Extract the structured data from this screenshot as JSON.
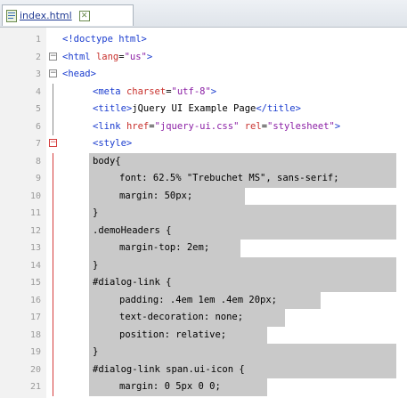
{
  "tab": {
    "filename": "index.html",
    "close_glyph": "✕",
    "file_icon": "html-file-icon"
  },
  "lines": [
    {
      "n": "1",
      "parts": [
        {
          "t": "<!",
          "c": "k-tag"
        },
        {
          "t": "doctype html",
          "c": "k-tag"
        },
        {
          "t": ">",
          "c": "k-tag"
        }
      ]
    },
    {
      "n": "2",
      "parts": [
        {
          "t": "<html ",
          "c": "k-tag"
        },
        {
          "t": "lang",
          "c": "k-attr"
        },
        {
          "t": "=",
          "c": "k-punct"
        },
        {
          "t": "\"us\"",
          "c": "k-str"
        },
        {
          "t": ">",
          "c": "k-tag"
        }
      ]
    },
    {
      "n": "3",
      "parts": [
        {
          "t": "<head>",
          "c": "k-tag"
        }
      ]
    },
    {
      "n": "4",
      "parts": [
        {
          "t": "<meta ",
          "c": "k-tag"
        },
        {
          "t": "charset",
          "c": "k-attr"
        },
        {
          "t": "=",
          "c": "k-punct"
        },
        {
          "t": "\"utf-8\"",
          "c": "k-str"
        },
        {
          "t": ">",
          "c": "k-tag"
        }
      ]
    },
    {
      "n": "5",
      "parts": [
        {
          "t": "<title>",
          "c": "k-tag"
        },
        {
          "t": "jQuery UI Example Page",
          "c": "k-text"
        },
        {
          "t": "</title>",
          "c": "k-tag"
        }
      ]
    },
    {
      "n": "6",
      "parts": [
        {
          "t": "<link ",
          "c": "k-tag"
        },
        {
          "t": "href",
          "c": "k-attr"
        },
        {
          "t": "=",
          "c": "k-punct"
        },
        {
          "t": "\"jquery-ui.css\"",
          "c": "k-str"
        },
        {
          "t": " rel",
          "c": "k-attr"
        },
        {
          "t": "=",
          "c": "k-punct"
        },
        {
          "t": "\"stylesheet\"",
          "c": "k-str"
        },
        {
          "t": ">",
          "c": "k-tag"
        }
      ]
    },
    {
      "n": "7",
      "parts": [
        {
          "t": "<style>",
          "c": "k-tag"
        }
      ]
    },
    {
      "n": "8",
      "parts": [
        {
          "t": "body{",
          "c": "k-sel"
        }
      ]
    },
    {
      "n": "9",
      "parts": [
        {
          "t": "font: 62.5% \"Trebuchet MS\", sans-serif;",
          "c": "k-sel"
        }
      ]
    },
    {
      "n": "10",
      "parts": [
        {
          "t": "margin: 50px;",
          "c": "k-sel"
        }
      ]
    },
    {
      "n": "11",
      "parts": [
        {
          "t": "}",
          "c": "k-sel"
        }
      ]
    },
    {
      "n": "12",
      "parts": [
        {
          "t": ".demoHeaders {",
          "c": "k-sel"
        }
      ]
    },
    {
      "n": "13",
      "parts": [
        {
          "t": "margin-top: 2em;",
          "c": "k-sel"
        }
      ]
    },
    {
      "n": "14",
      "parts": [
        {
          "t": "}",
          "c": "k-sel"
        }
      ]
    },
    {
      "n": "15",
      "parts": [
        {
          "t": "#dialog-link {",
          "c": "k-sel"
        }
      ]
    },
    {
      "n": "16",
      "parts": [
        {
          "t": "padding: .4em 1em .4em 20px;",
          "c": "k-sel"
        }
      ]
    },
    {
      "n": "17",
      "parts": [
        {
          "t": "text-decoration: none;",
          "c": "k-sel"
        }
      ]
    },
    {
      "n": "18",
      "parts": [
        {
          "t": "position: relative;",
          "c": "k-sel"
        }
      ]
    },
    {
      "n": "19",
      "parts": [
        {
          "t": "}",
          "c": "k-sel"
        }
      ]
    },
    {
      "n": "20",
      "parts": [
        {
          "t": "#dialog-link span.ui-icon {",
          "c": "k-sel"
        }
      ]
    },
    {
      "n": "21",
      "parts": [
        {
          "t": "margin: 0 5px 0 0;",
          "c": "k-sel"
        }
      ]
    }
  ]
}
